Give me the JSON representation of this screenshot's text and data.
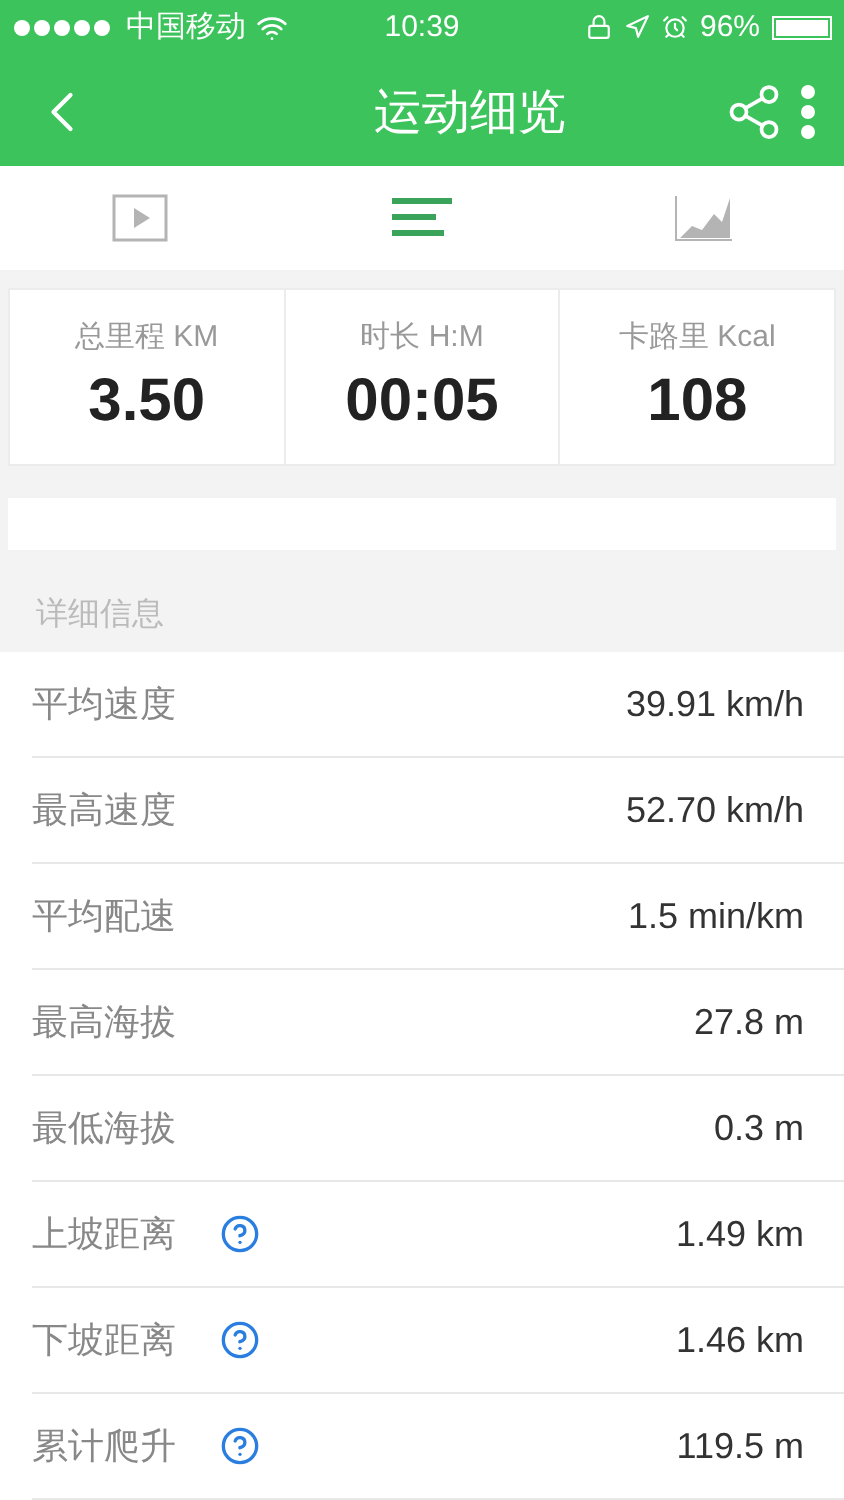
{
  "status_bar": {
    "carrier": "中国移动",
    "time": "10:39",
    "battery": "96%"
  },
  "nav": {
    "title": "运动细览"
  },
  "tabs": [
    {
      "kind": "video",
      "selected": false
    },
    {
      "kind": "list",
      "selected": true
    },
    {
      "kind": "chart",
      "selected": false
    }
  ],
  "stats": [
    {
      "label": "总里程 KM",
      "value": "3.50"
    },
    {
      "label": "时长 H:M",
      "value": "00:05"
    },
    {
      "label": "卡路里 Kcal",
      "value": "108"
    }
  ],
  "section": "详细信息",
  "rows": [
    {
      "label": "平均速度",
      "value": "39.91 km/h",
      "help": false
    },
    {
      "label": "最高速度",
      "value": "52.70 km/h",
      "help": false
    },
    {
      "label": "平均配速",
      "value": "1.5 min/km",
      "help": false
    },
    {
      "label": "最高海拔",
      "value": "27.8 m",
      "help": false
    },
    {
      "label": "最低海拔",
      "value": "0.3 m",
      "help": false
    },
    {
      "label": "上坡距离",
      "value": "1.49 km",
      "help": true
    },
    {
      "label": "下坡距离",
      "value": "1.46 km",
      "help": true
    },
    {
      "label": "累计爬升",
      "value": "119.5 m",
      "help": true
    }
  ]
}
